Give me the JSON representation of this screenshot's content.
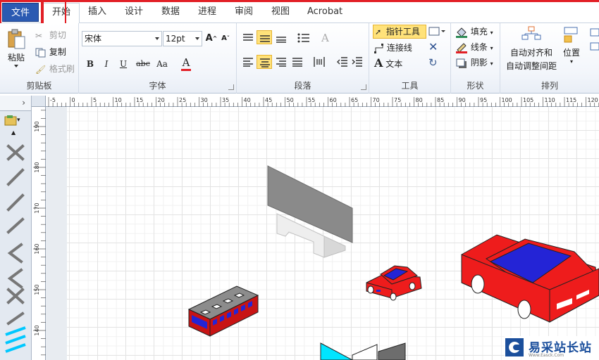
{
  "tabs": {
    "file": "文件",
    "items": [
      "开始",
      "插入",
      "设计",
      "数据",
      "进程",
      "审阅",
      "视图",
      "Acrobat"
    ]
  },
  "clipboard": {
    "paste": "粘贴",
    "cut": "剪切",
    "copy": "复制",
    "format_painter": "格式刷",
    "label": "剪贴板"
  },
  "font": {
    "name": "宋体",
    "size": "12pt",
    "label": "字体",
    "bold": "B",
    "italic": "I",
    "underline": "U",
    "strike": "abc",
    "case": "Aa",
    "color_a": "A",
    "grow": "A",
    "shrink": "A"
  },
  "paragraph": {
    "label": "段落"
  },
  "tools": {
    "pointer": "指针工具",
    "connector": "连接线",
    "text": "文本",
    "text_glyph": "A",
    "label": "工具"
  },
  "shape": {
    "fill": "填充",
    "line": "线条",
    "shadow": "阴影",
    "label": "形状"
  },
  "arrange": {
    "auto_align_1": "自动对齐和",
    "auto_align_2": "自动调整间距",
    "position": "位置",
    "label": "排列"
  },
  "ruler": {
    "h_ticks": [
      "-5",
      "0",
      "5",
      "10",
      "15",
      "20",
      "25",
      "30",
      "35",
      "40",
      "45",
      "50",
      "55",
      "60",
      "65",
      "70",
      "75",
      "80",
      "85",
      "90",
      "95",
      "100",
      "105",
      "110",
      "115",
      "120"
    ],
    "v_ticks": [
      "190",
      "180",
      "170",
      "160",
      "150",
      "140"
    ]
  },
  "watermark": {
    "text": "易采站长站",
    "sub": "Www.Easck.Com"
  },
  "colors": {
    "accent_red": "#e21f26",
    "file_tab": "#2b5ab2",
    "car_red": "#ee1c1c",
    "car_blue": "#2424d6",
    "gray_shape": "#8a8a8a",
    "cyan": "#00e5ff"
  }
}
